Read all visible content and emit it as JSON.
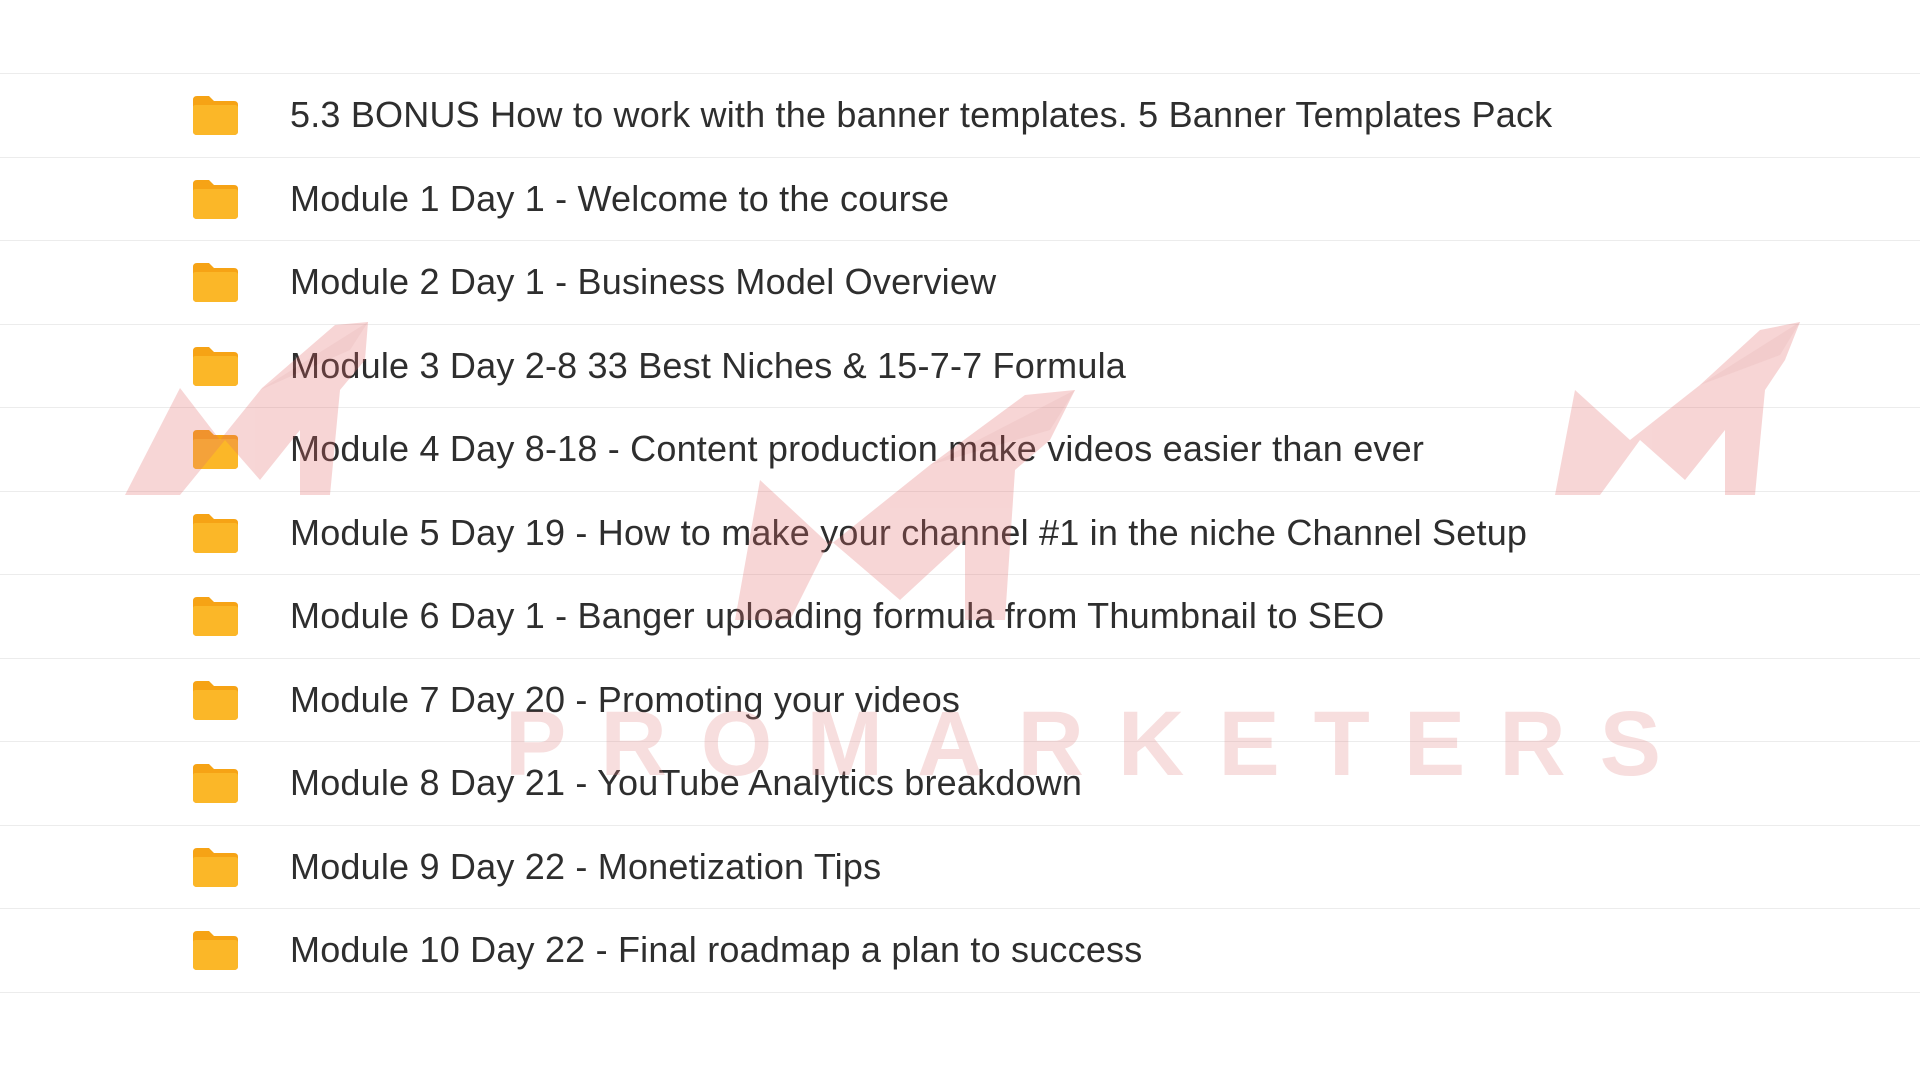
{
  "folder_icon": {
    "name": "folder-icon",
    "color": "#F9B21D",
    "tab_color": "#F6A315"
  },
  "rows": [
    {
      "label": "5.3 BONUS How to work with the banner templates. 5 Banner Templates Pack"
    },
    {
      "label": "Module 1 Day 1 - Welcome to the course"
    },
    {
      "label": "Module 2 Day 1 - Business Model Overview"
    },
    {
      "label": "Module 3 Day 2-8 33 Best Niches & 15-7-7 Formula"
    },
    {
      "label": "Module 4 Day 8-18 - Content production make videos easier than ever"
    },
    {
      "label": "Module 5 Day 19 - How to make your channel #1 in the niche Channel Setup"
    },
    {
      "label": "Module 6 Day 1 - Banger uploading formula from Thumbnail to SEO"
    },
    {
      "label": "Module 7 Day 20 - Promoting your videos"
    },
    {
      "label": "Module 8 Day 21 - YouTube Analytics breakdown"
    },
    {
      "label": "Module 9 Day 22 - Monetization Tips"
    },
    {
      "label": "Module 10 Day 22 - Final roadmap a plan to success"
    }
  ],
  "watermark": {
    "text": "PROMARKETERS",
    "color": "#E28A8A"
  }
}
